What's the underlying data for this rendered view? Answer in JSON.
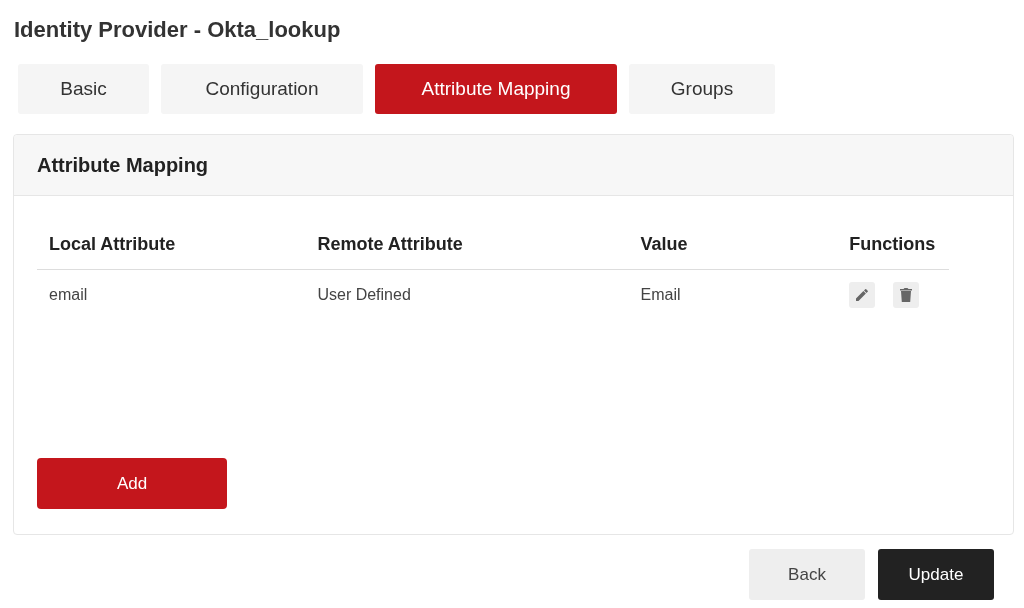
{
  "page": {
    "title": "Identity Provider - Okta_lookup"
  },
  "tabs": [
    {
      "label": "Basic",
      "selected": false
    },
    {
      "label": "Configuration",
      "selected": false
    },
    {
      "label": "Attribute Mapping",
      "selected": true
    },
    {
      "label": "Groups",
      "selected": false
    }
  ],
  "panel": {
    "title": "Attribute Mapping"
  },
  "table": {
    "columns": [
      "Local Attribute",
      "Remote Attribute",
      "Value",
      "Functions"
    ],
    "rows": [
      {
        "cells": [
          "email",
          "User Defined",
          "Email"
        ]
      }
    ]
  },
  "add_button": "Add",
  "buttons": [
    {
      "label": "Back",
      "kind": "secondary"
    },
    {
      "label": "Update",
      "kind": "primary"
    }
  ]
}
